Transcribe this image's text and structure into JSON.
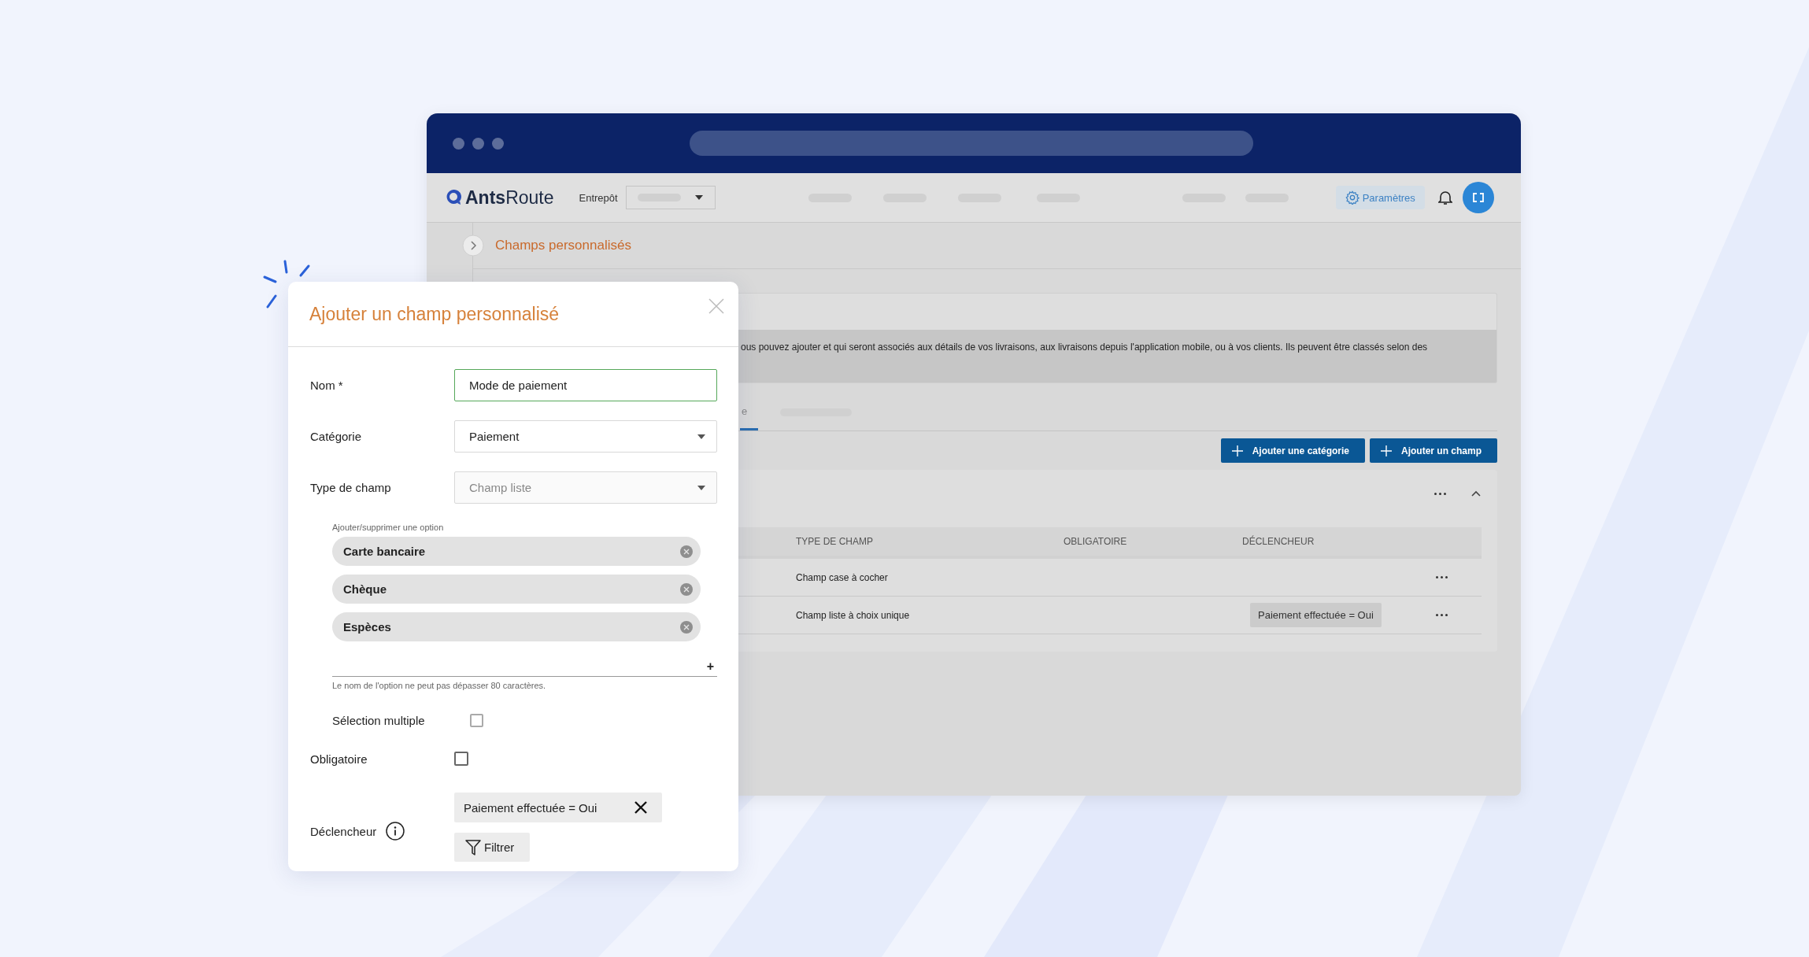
{
  "header": {
    "logo": "**Ants**Route",
    "warehouse_label": "Entrepôt",
    "settings_button": "Paramètres"
  },
  "breadcrumb": "Champs personnalisés",
  "info_text": "ous pouvez ajouter et qui seront associés aux détails de vos livraisons, aux livraisons depuis l'application mobile, ou à vos clients. Ils peuvent être classés selon des",
  "tabs": [
    {
      "label": "e",
      "selected": true
    }
  ],
  "actions": [
    {
      "label": "Ajouter une catégorie"
    },
    {
      "label": "Ajouter un champ"
    }
  ],
  "table": {
    "columns": [
      "TYPE DE CHAMP",
      "OBLIGATOIRE",
      "DÉCLENCHEUR"
    ],
    "rows": [
      {
        "type": "Champ case à cocher"
      },
      {
        "type": "Champ liste à choix unique",
        "trigger": "Paiement effectuée = Oui"
      }
    ]
  },
  "modal": {
    "title": "Ajouter un champ personnalisé",
    "fields": [
      {
        "kind": "text",
        "label": "Nom *",
        "value": "Mode de paiement",
        "focused": true,
        "disabled": false
      },
      {
        "kind": "select",
        "label": "Catégorie",
        "value": "Paiement",
        "focused": false,
        "disabled": false
      },
      {
        "kind": "select",
        "label": "Type de champ",
        "value": "Champ liste",
        "focused": false,
        "disabled": true
      }
    ],
    "options_label": "Ajouter/supprimer une option",
    "options": [
      "Carte bancaire",
      "Chèque",
      "Espèces"
    ],
    "add_button": "+",
    "options_hint": "Le nom de l'option ne peut pas dépasser 80 caractères.",
    "multiple": {
      "label": "Sélection multiple",
      "checked": false
    },
    "required": {
      "label": "Obligatoire",
      "checked": false
    },
    "trigger": {
      "label": "Déclencheur",
      "condition": "Paiement effectuée = Oui",
      "filter_button": "Filtrer"
    }
  }
}
